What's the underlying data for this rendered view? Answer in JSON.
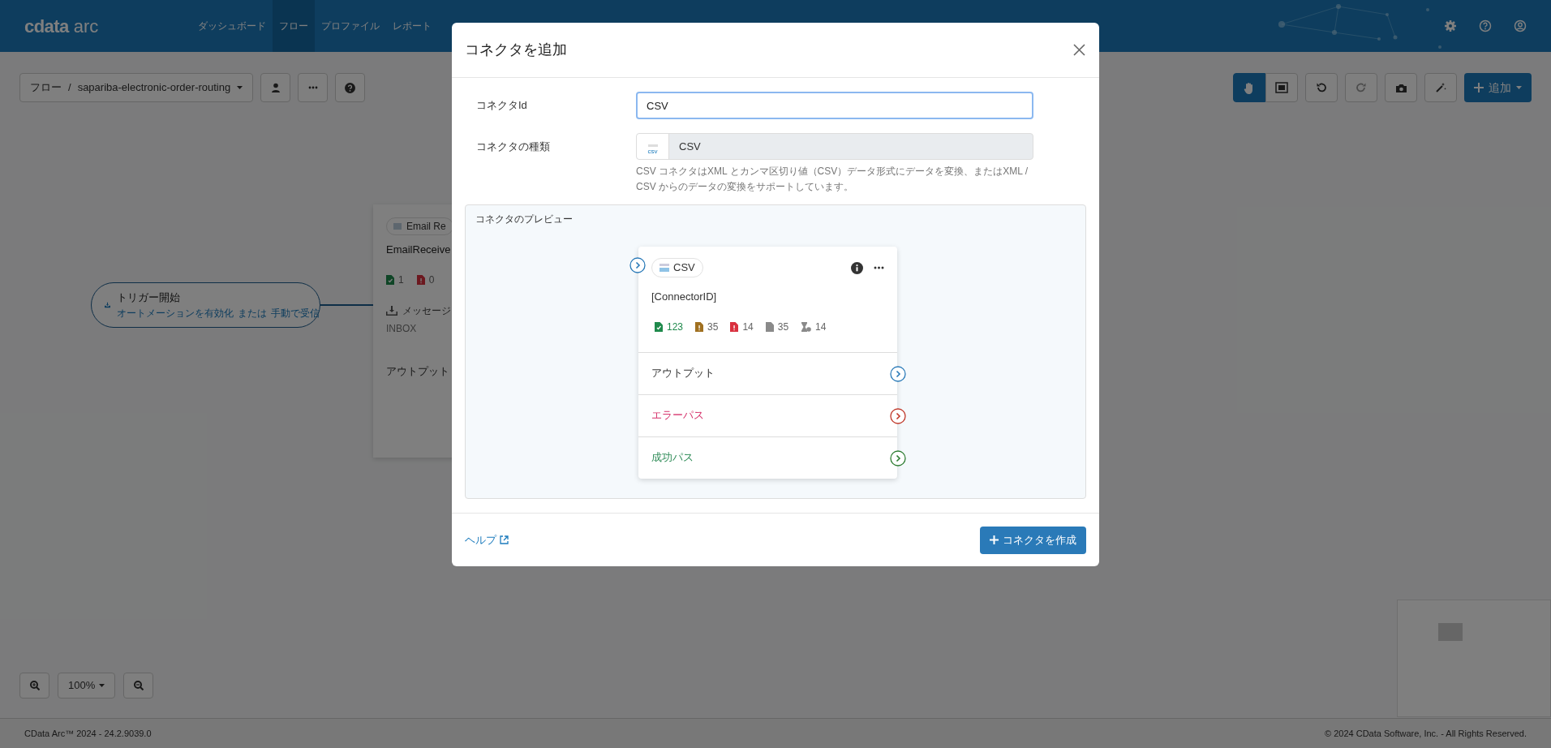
{
  "header": {
    "logo_mark": "cdata",
    "logo_text": "arc",
    "nav": [
      {
        "label": "ダッシュボード",
        "selected": false
      },
      {
        "label": "フロー",
        "selected": true
      },
      {
        "label": "プロファイル",
        "selected": false
      },
      {
        "label": "レポート",
        "selected": false
      }
    ],
    "actions": [
      {
        "kind": "settings"
      },
      {
        "kind": "help"
      },
      {
        "kind": "account"
      }
    ]
  },
  "breadcrumb": {
    "root": "フロー",
    "separator": "/",
    "flow": "sapariba-electronic-order-routing",
    "buttons": [
      {
        "kind": "user"
      },
      {
        "kind": "more"
      },
      {
        "kind": "help"
      }
    ]
  },
  "toolbar": {
    "tools": [
      {
        "kind": "hand",
        "selected": true
      },
      {
        "kind": "fit",
        "selected": false
      },
      {
        "kind": "undo",
        "selected": false
      },
      {
        "kind": "redo",
        "selected": false
      },
      {
        "kind": "camera",
        "selected": false
      },
      {
        "kind": "wand",
        "selected": false
      }
    ],
    "add_button": "追加"
  },
  "canvas": {
    "trigger": {
      "title": "トリガー開始",
      "line_parts": [
        "オートメーションを有効化",
        "または",
        "手動で受信"
      ]
    },
    "node": {
      "badge": "Email Re",
      "name": "EmailReceive",
      "counts": [
        {
          "kind": "success",
          "value": "1"
        },
        {
          "kind": "error",
          "value": "0"
        }
      ],
      "setting": "メッセージ",
      "folder": "INBOX",
      "output": "アウトプット"
    }
  },
  "zoom": {
    "level": "100%"
  },
  "modal": {
    "title": "コネクタを追加",
    "id_label": "コネクタId",
    "id_value": "CSV",
    "type_label": "コネクタの種類",
    "type_icon_text": "csv",
    "type_value": "CSV",
    "description": "CSV コネクタはXML とカンマ区切り値（CSV）データ形式にデータを変換、またはXML / CSV からのデータの変換をサポートしています。",
    "preview": {
      "label": "コネクタのプレビュー",
      "badge": "CSV",
      "name": "[ConnectorID]",
      "stats": [
        {
          "kind": "success",
          "value": "123"
        },
        {
          "kind": "warning",
          "value": "35"
        },
        {
          "kind": "error",
          "value": "14"
        },
        {
          "kind": "pending",
          "value": "35"
        },
        {
          "kind": "hold",
          "value": "14"
        }
      ],
      "paths": [
        {
          "kind": "output",
          "label": "アウトプット"
        },
        {
          "kind": "error",
          "label": "エラーパス"
        },
        {
          "kind": "success",
          "label": "成功パス"
        }
      ]
    },
    "help_link": "ヘルプ",
    "create_button": "コネクタを作成"
  },
  "footer": {
    "version": "CData Arc™ 2024 - 24.2.9039.0",
    "copyright": "© 2024 CData Software, Inc. - All Rights Reserved."
  }
}
